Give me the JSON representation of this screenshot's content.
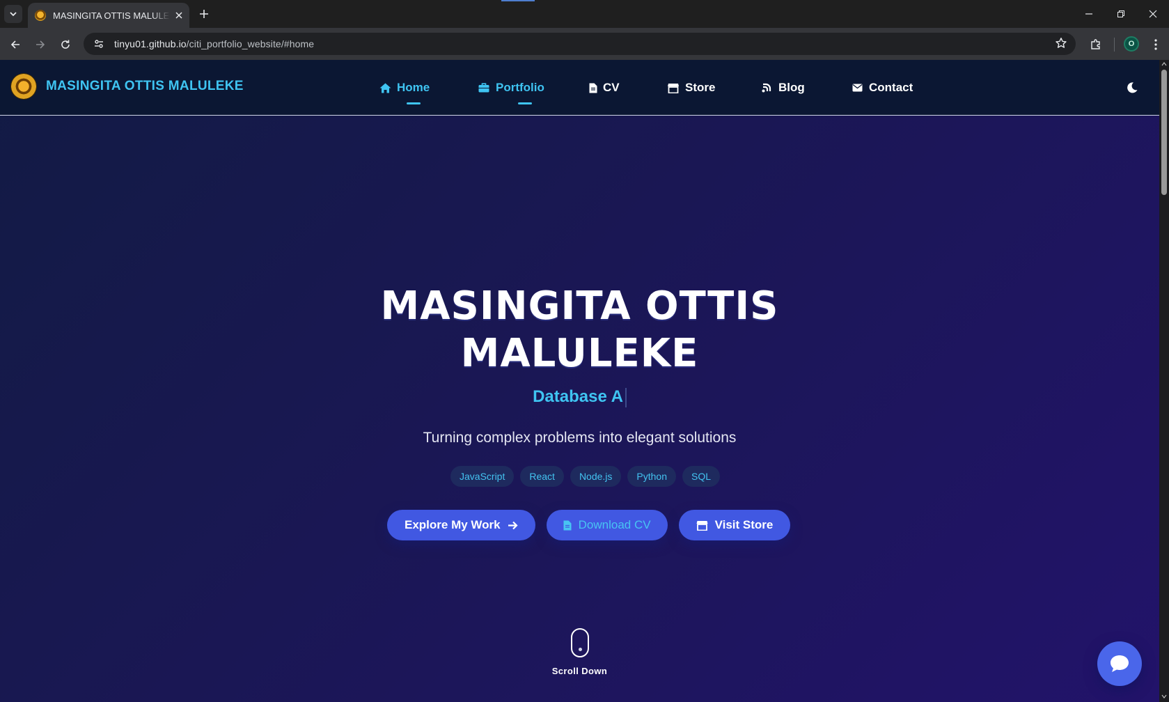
{
  "browser": {
    "tab_title": "MASINGITA OTTIS MALULEKE - ",
    "url_host": "tinyu01.github.io",
    "url_path": "/citi_portfolio_website/#home",
    "profile_initial": "O"
  },
  "site": {
    "brand_name": "MASINGITA OTTIS MALULEKE",
    "nav": [
      {
        "label": "Home",
        "icon": "home-icon",
        "active": true
      },
      {
        "label": "Portfolio",
        "icon": "briefcase-icon",
        "active": true
      },
      {
        "label": "CV",
        "icon": "file-icon",
        "active": false
      },
      {
        "label": "Store",
        "icon": "store-icon",
        "active": false
      },
      {
        "label": "Blog",
        "icon": "blog-icon",
        "active": false
      },
      {
        "label": "Contact",
        "icon": "envelope-icon",
        "active": false
      }
    ],
    "theme_toggle_icon": "moon-icon"
  },
  "hero": {
    "title_line1": "MASINGITA OTTIS",
    "title_line2": "MALULEKE",
    "role_typed": "Database A",
    "tagline": "Turning complex problems into elegant solutions",
    "skills": [
      "JavaScript",
      "React",
      "Node.js",
      "Python",
      "SQL"
    ],
    "buttons": {
      "explore": "Explore My Work",
      "download": "Download CV",
      "store": "Visit Store"
    },
    "scroll_label": "Scroll Down"
  },
  "colors": {
    "accent": "#3fc4f2",
    "button": "#4158e2",
    "nav_bg": "#0b1733",
    "hero_bg_start": "#121b44",
    "hero_bg_end": "#22136a"
  }
}
